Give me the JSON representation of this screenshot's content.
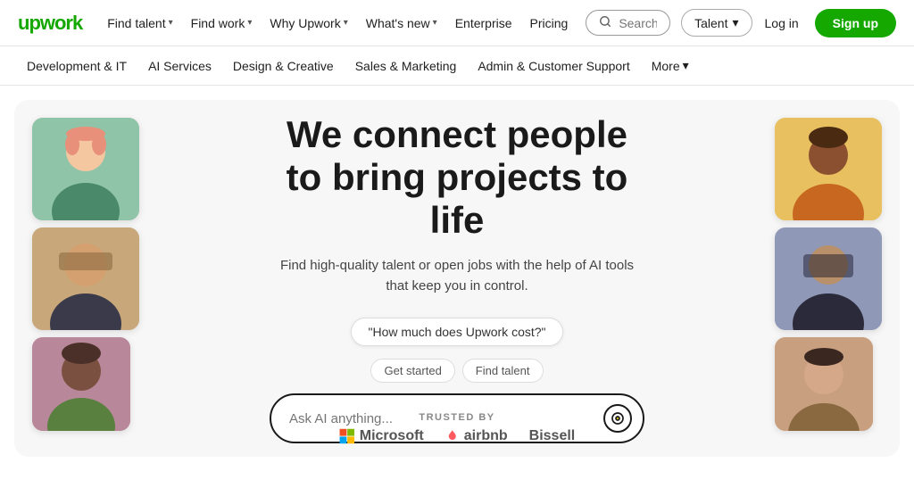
{
  "logo": {
    "text": "upwork"
  },
  "topNav": {
    "items": [
      {
        "label": "Find talent",
        "hasDropdown": true
      },
      {
        "label": "Find work",
        "hasDropdown": true
      },
      {
        "label": "Why Upwork",
        "hasDropdown": true
      },
      {
        "label": "What's new",
        "hasDropdown": true
      },
      {
        "label": "Enterprise",
        "hasDropdown": false
      },
      {
        "label": "Pricing",
        "hasDropdown": false
      }
    ],
    "searchPlaceholder": "Search",
    "talentDropdown": "Talent",
    "loginLabel": "Log in",
    "signupLabel": "Sign up"
  },
  "secondaryNav": {
    "items": [
      "Development & IT",
      "AI Services",
      "Design & Creative",
      "Sales & Marketing",
      "Admin & Customer Support"
    ],
    "moreLabel": "More"
  },
  "hero": {
    "title": "We connect people to bring projects to life",
    "subtitle": "Find high-quality talent or open jobs with the help of AI tools that keep you in control.",
    "aiSuggestion": "\"How much does Upwork cost?\"",
    "chips": [
      "Get started",
      "Find talent"
    ],
    "aiInputPlaceholder": "Ask AI anything...",
    "trustedBy": {
      "label": "TRUSTED BY",
      "logos": [
        "Microsoft",
        "airbnb",
        "Bissell"
      ]
    }
  }
}
